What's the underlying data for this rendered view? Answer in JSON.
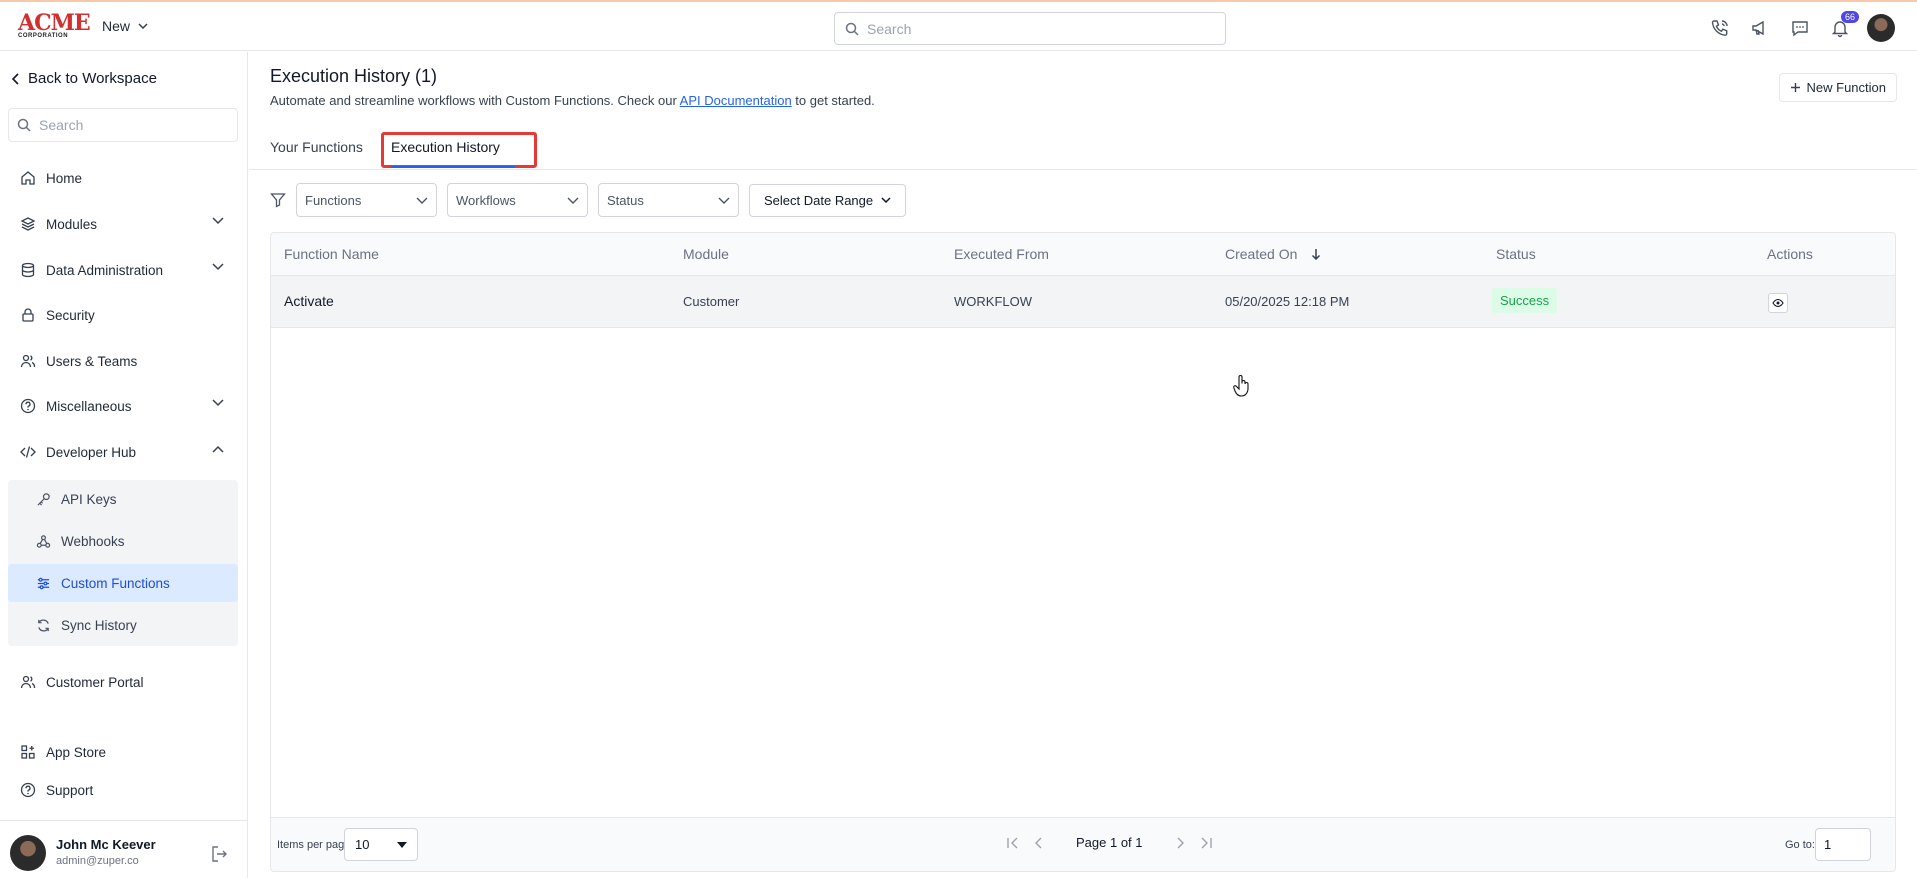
{
  "header": {
    "logo_main": "ACME",
    "logo_sub": "CORPORATION",
    "new_label": "New",
    "search_placeholder": "Search",
    "notification_count": "66"
  },
  "sidebar": {
    "back_label": "Back to Workspace",
    "search_placeholder": "Search",
    "items": [
      {
        "label": "Home",
        "icon": "home-icon"
      },
      {
        "label": "Modules",
        "icon": "layers-icon"
      },
      {
        "label": "Data Administration",
        "icon": "database-icon"
      },
      {
        "label": "Security",
        "icon": "lock-icon"
      },
      {
        "label": "Users & Teams",
        "icon": "users-icon"
      },
      {
        "label": "Miscellaneous",
        "icon": "help-circle-icon"
      },
      {
        "label": "Developer Hub",
        "icon": "code-icon"
      }
    ],
    "dev_sub_items": [
      {
        "label": "API Keys",
        "icon": "key-icon"
      },
      {
        "label": "Webhooks",
        "icon": "webhook-icon"
      },
      {
        "label": "Custom Functions",
        "icon": "sliders-icon"
      },
      {
        "label": "Sync History",
        "icon": "sync-icon"
      }
    ],
    "lower_items": [
      {
        "label": "Customer Portal",
        "icon": "users-icon"
      },
      {
        "label": "App Store",
        "icon": "apps-icon"
      },
      {
        "label": "Support",
        "icon": "help-circle-icon"
      }
    ],
    "user": {
      "name": "John Mc Keever",
      "email": "admin@zuper.co"
    }
  },
  "main": {
    "title": "Execution History (1)",
    "subtitle_before": "Automate and streamline workflows with Custom Functions. Check our ",
    "subtitle_link": "API Documentation",
    "subtitle_after": " to get started.",
    "new_function_label": "New Function",
    "tabs": [
      {
        "label": "Your Functions"
      },
      {
        "label": "Execution History",
        "active": true
      }
    ],
    "filters": {
      "functions": "Functions",
      "workflows": "Workflows",
      "status": "Status",
      "date_range": "Select Date Range"
    },
    "table": {
      "columns": [
        "Function Name",
        "Module",
        "Executed From",
        "Created On",
        "Status",
        "Actions"
      ],
      "rows": [
        {
          "function_name": "Activate",
          "module": "Customer",
          "executed_from": "WORKFLOW",
          "created_on": "05/20/2025 12:18 PM",
          "status": "Success"
        }
      ]
    },
    "pagination": {
      "items_per_page_label": "Items per page",
      "items_per_page_value": "10",
      "page_text": "Page 1 of 1",
      "goto_label": "Go to:",
      "goto_value": "1"
    }
  },
  "colors": {
    "accent": "#2563eb",
    "highlight": "#e53935",
    "success_bg": "#dcfce7",
    "success_text": "#16a34a",
    "brand": "#d32f2f"
  }
}
